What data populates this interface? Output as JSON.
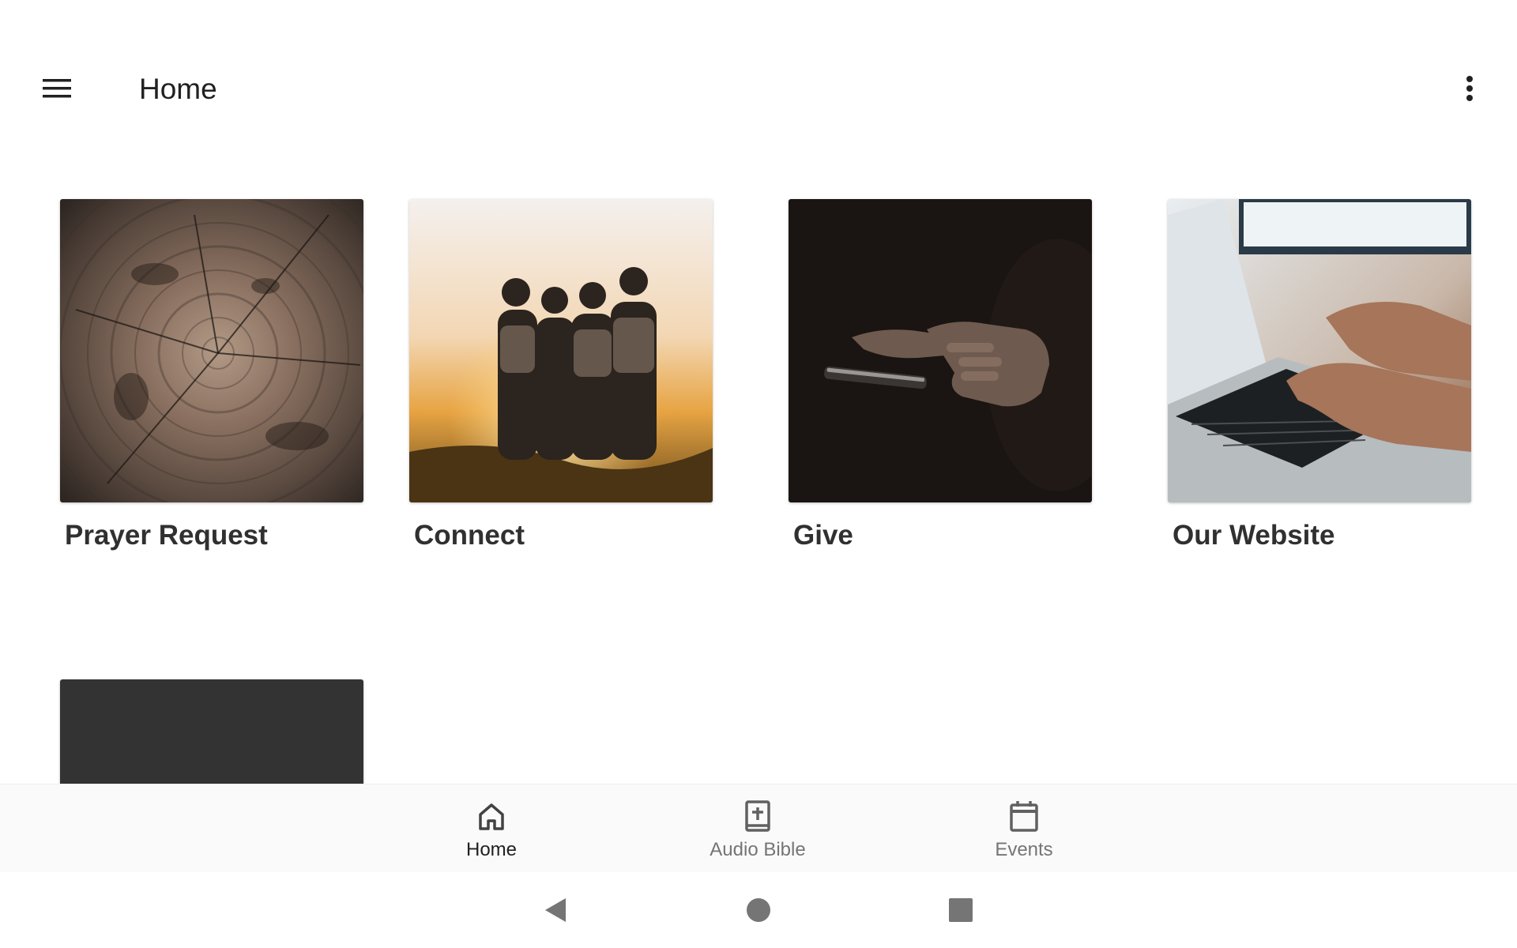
{
  "appbar": {
    "title": "Home",
    "menu_icon": "hamburger-menu-icon",
    "overflow_icon": "more-vert-icon"
  },
  "tiles": [
    {
      "label": "Prayer Request",
      "image": "tree-rings-photo"
    },
    {
      "label": "Connect",
      "image": "friends-sunset-photo"
    },
    {
      "label": "Give",
      "image": "phone-in-hands-photo"
    },
    {
      "label": "Our Website",
      "image": "laptop-typing-photo"
    },
    {
      "label": "",
      "image": "dark-placeholder"
    }
  ],
  "bottom_nav": {
    "items": [
      {
        "label": "Home",
        "icon": "home-icon",
        "active": true
      },
      {
        "label": "Audio Bible",
        "icon": "bible-icon",
        "active": false
      },
      {
        "label": "Events",
        "icon": "calendar-icon",
        "active": false
      }
    ]
  },
  "system_nav": {
    "back_icon": "back-triangle-icon",
    "home_icon": "home-circle-icon",
    "recents_icon": "recents-square-icon"
  },
  "colors": {
    "background": "#ffffff",
    "text_primary": "#212121",
    "text_secondary": "#757575",
    "placeholder_tile": "#333333"
  }
}
